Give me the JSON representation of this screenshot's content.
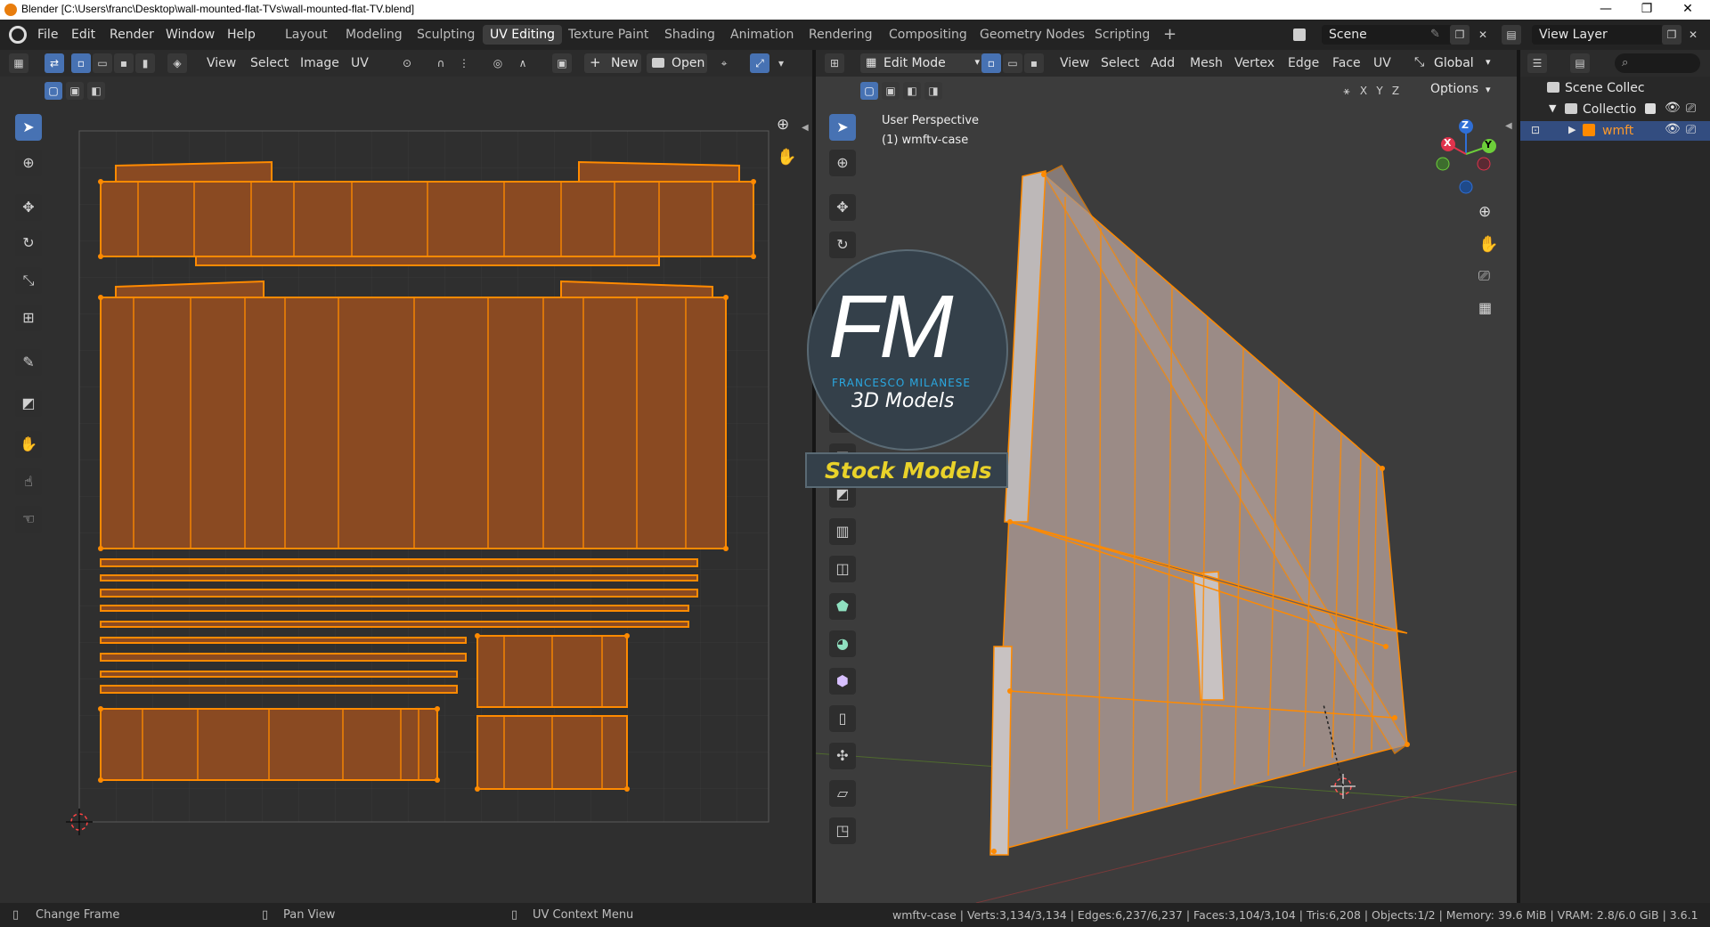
{
  "titlebar": {
    "title": "Blender [C:\\Users\\franc\\Desktop\\wall-mounted-flat-TVs\\wall-mounted-flat-TV.blend]",
    "minimize": "—",
    "restore": "❐",
    "close": "✕"
  },
  "menus": [
    "File",
    "Edit",
    "Render",
    "Window",
    "Help"
  ],
  "workspaces": [
    {
      "label": "Layout"
    },
    {
      "label": "Modeling"
    },
    {
      "label": "Sculpting"
    },
    {
      "label": "UV Editing",
      "active": true
    },
    {
      "label": "Texture Paint"
    },
    {
      "label": "Shading"
    },
    {
      "label": "Animation"
    },
    {
      "label": "Rendering"
    },
    {
      "label": "Compositing"
    },
    {
      "label": "Geometry Nodes"
    },
    {
      "label": "Scripting"
    }
  ],
  "add_workspace": "+",
  "scene": {
    "value": "Scene"
  },
  "view_layer": {
    "value": "View Layer"
  },
  "uv_editor": {
    "menus": [
      "View",
      "Select",
      "Image",
      "UV"
    ],
    "new_label": "New",
    "open_label": "Open",
    "tools": [
      "select-box",
      "cursor",
      "move",
      "rotate",
      "scale",
      "transform",
      "annotate",
      "rip",
      "grab",
      "relax",
      "pinch"
    ]
  },
  "viewport": {
    "mode": "Edit Mode",
    "menus": [
      "View",
      "Select",
      "Add",
      "Mesh",
      "Vertex",
      "Edge",
      "Face",
      "UV"
    ],
    "orientation": "Global",
    "options_label": "Options",
    "axis_x": "X",
    "axis_y": "Y",
    "axis_z": "Z",
    "overlay_title": "User Perspective",
    "overlay_object": "(1) wmftv-case",
    "gizmo": {
      "x": "X",
      "y": "Y",
      "z": "Z"
    }
  },
  "watermark": {
    "logo": "FM",
    "name": "FRANCESCO MILANESE",
    "subtitle": "3D Models",
    "banner": "Stock Models"
  },
  "outliner": {
    "scene_collection": "Scene Collec",
    "collection": "Collectio",
    "object": "wmft"
  },
  "status": {
    "left_action": "Change Frame",
    "middle_action": "Pan View",
    "right_action": "UV Context Menu",
    "stats": "wmftv-case | Verts:3,134/3,134 | Edges:6,237/6,237 | Faces:3,104/3,104 | Tris:6,208 | Objects:1/2 | Memory: 39.6 MiB | VRAM: 2.8/6.0 GiB | 3.6.1"
  },
  "colors": {
    "accent": "#4772b3",
    "selection": "#ff8a00",
    "uv_fill": "#8a4a22",
    "mesh_fill": "#9a8a86",
    "watermark_blue": "#2aa7e0",
    "watermark_yellow": "#e9d22a"
  }
}
